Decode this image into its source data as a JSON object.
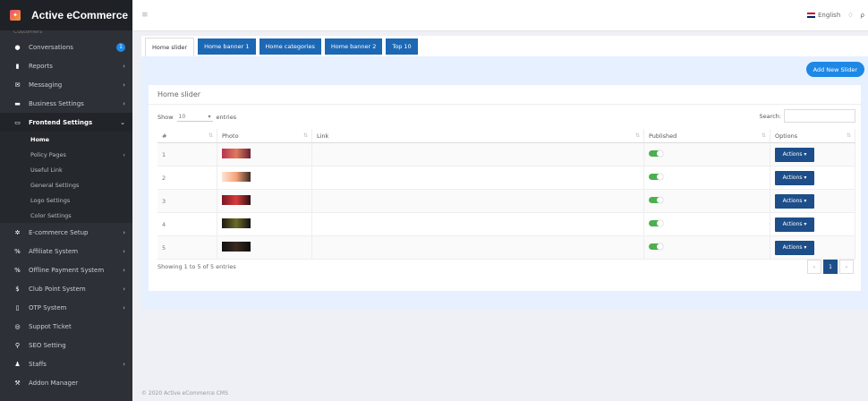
{
  "app": {
    "title": "Active eCommerce"
  },
  "topbar": {
    "language": "English"
  },
  "sidebar": {
    "cut_item": "Customers",
    "items": [
      {
        "label": "Conversations",
        "icon": "chat-icon",
        "badge": "1"
      },
      {
        "label": "Reports",
        "icon": "file-icon",
        "chevron": true
      },
      {
        "label": "Messaging",
        "icon": "envelope-icon",
        "chevron": true
      },
      {
        "label": "Business Settings",
        "icon": "briefcase-icon",
        "chevron": true
      },
      {
        "label": "Frontend Settings",
        "icon": "desktop-icon",
        "chevron": true,
        "active": true
      }
    ],
    "subitems": [
      {
        "label": "Home",
        "current": true
      },
      {
        "label": "Policy Pages",
        "chevron": true
      },
      {
        "label": "Useful Link"
      },
      {
        "label": "General Settings"
      },
      {
        "label": "Logo Settings"
      },
      {
        "label": "Color Settings"
      }
    ],
    "items2": [
      {
        "label": "E-commerce Setup",
        "icon": "gear-icon",
        "chevron": true
      },
      {
        "label": "Affiliate System",
        "icon": "percent-icon",
        "chevron": true
      },
      {
        "label": "Offline Payment System",
        "icon": "percent-icon",
        "chevron": true
      },
      {
        "label": "Club Point System",
        "icon": "dollar-icon",
        "chevron": true
      },
      {
        "label": "OTP System",
        "icon": "phone-icon",
        "chevron": true
      },
      {
        "label": "Suppot Ticket",
        "icon": "lifebuoy-icon"
      },
      {
        "label": "SEO Setting",
        "icon": "search-icon"
      },
      {
        "label": "Staffs",
        "icon": "user-icon",
        "chevron": true
      },
      {
        "label": "Addon Manager",
        "icon": "wrench-icon"
      }
    ]
  },
  "tabs": [
    "Home slider",
    "Home banner 1",
    "Home categories",
    "Home banner 2",
    "Top 10"
  ],
  "content": {
    "add_button": "Add New Slider",
    "card_title": "Home slider",
    "show_label": "Show",
    "show_value": "10",
    "entries_label": "entries",
    "search_label": "Search:",
    "columns": [
      "#",
      "Photo",
      "Link",
      "Published",
      "Options"
    ],
    "rows": [
      {
        "num": "1",
        "link": "",
        "published": true,
        "action": "Actions"
      },
      {
        "num": "2",
        "link": "",
        "published": true,
        "action": "Actions"
      },
      {
        "num": "3",
        "link": "",
        "published": true,
        "action": "Actions"
      },
      {
        "num": "4",
        "link": "",
        "published": true,
        "action": "Actions"
      },
      {
        "num": "5",
        "link": "",
        "published": true,
        "action": "Actions"
      }
    ],
    "thumb_colors": [
      "#b8324e",
      "#f5c9a6",
      "#8a1e2a",
      "#2a2a1a",
      "#1a1a1a"
    ],
    "info": "Showing 1 to 5 of 5 entries",
    "page": "1"
  },
  "footer": "© 2020 Active eCommerce CMS"
}
